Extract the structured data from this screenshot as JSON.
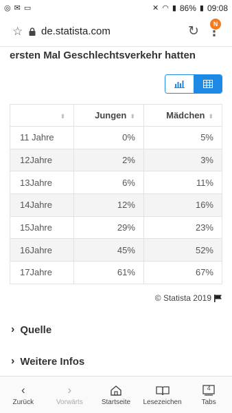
{
  "status": {
    "battery": "86%",
    "time": "09:08"
  },
  "browser": {
    "url": "de.statista.com",
    "menu_badge": "N"
  },
  "page": {
    "heading": "ersten Mal Geschlechtsverkehr hatten",
    "table": {
      "headers": [
        "",
        "Jungen",
        "Mädchen"
      ],
      "rows": [
        [
          "11 Jahre",
          "0%",
          "5%"
        ],
        [
          "12Jahre",
          "2%",
          "3%"
        ],
        [
          "13Jahre",
          "6%",
          "11%"
        ],
        [
          "14Jahre",
          "12%",
          "16%"
        ],
        [
          "15Jahre",
          "29%",
          "23%"
        ],
        [
          "16Jahre",
          "45%",
          "52%"
        ],
        [
          "17Jahre",
          "61%",
          "67%"
        ]
      ]
    },
    "copyright": "© Statista 2019",
    "sections": [
      "Quelle",
      "Weitere Infos"
    ]
  },
  "nav": {
    "back": "Zurück",
    "forward": "Vorwärts",
    "home": "Startseite",
    "bookmarks": "Lesezeichen",
    "tabs": "Tabs",
    "tab_count": "4"
  },
  "colors": {
    "accent": "#1e88e5",
    "badge": "#f47c20"
  }
}
